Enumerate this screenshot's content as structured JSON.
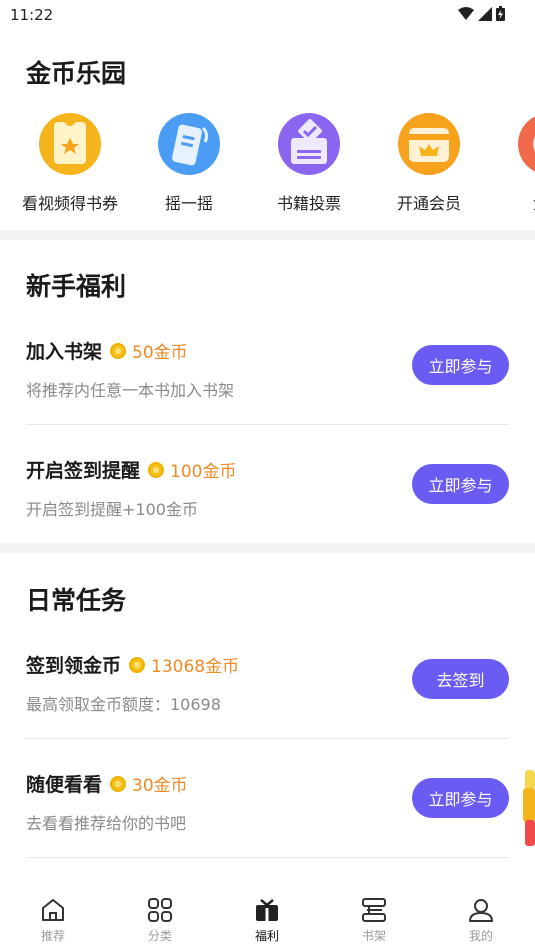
{
  "status": {
    "time": "11:22"
  },
  "header": {
    "title": "金币乐园"
  },
  "features": [
    {
      "label": "看视频得书券",
      "icon": "ticket-icon",
      "color": "#f6b41c"
    },
    {
      "label": "摇一摇",
      "icon": "phone-shake-icon",
      "color": "#4a9cf5"
    },
    {
      "label": "书籍投票",
      "icon": "vote-icon",
      "color": "#8a66f0"
    },
    {
      "label": "开通会员",
      "icon": "vip-card-icon",
      "color": "#f6a21c"
    },
    {
      "label": "金币",
      "icon": "coin-icon",
      "color": "#f06a4a"
    }
  ],
  "newbie": {
    "title": "新手福利",
    "tasks": [
      {
        "title": "加入书架",
        "reward": "50金币",
        "desc": "将推荐内任意一本书加入书架",
        "button": "立即参与"
      },
      {
        "title": "开启签到提醒",
        "reward": "100金币",
        "desc": "开启签到提醒+100金币",
        "button": "立即参与"
      }
    ]
  },
  "daily": {
    "title": "日常任务",
    "tasks": [
      {
        "title": "签到领金币",
        "reward": "13068金币",
        "desc": "最高领取金币额度：10698",
        "button": "去签到"
      },
      {
        "title": "随便看看",
        "reward": "30金币",
        "desc": "去看看推荐给你的书吧",
        "button": "立即参与"
      }
    ]
  },
  "tabs": [
    {
      "label": "推荐",
      "icon": "home-icon"
    },
    {
      "label": "分类",
      "icon": "grid-icon"
    },
    {
      "label": "福利",
      "icon": "gift-icon",
      "active": true
    },
    {
      "label": "书架",
      "icon": "bookshelf-icon"
    },
    {
      "label": "我的",
      "icon": "user-icon"
    }
  ],
  "colors": {
    "accent": "#6a5cf2",
    "reward": "#f08a24"
  }
}
